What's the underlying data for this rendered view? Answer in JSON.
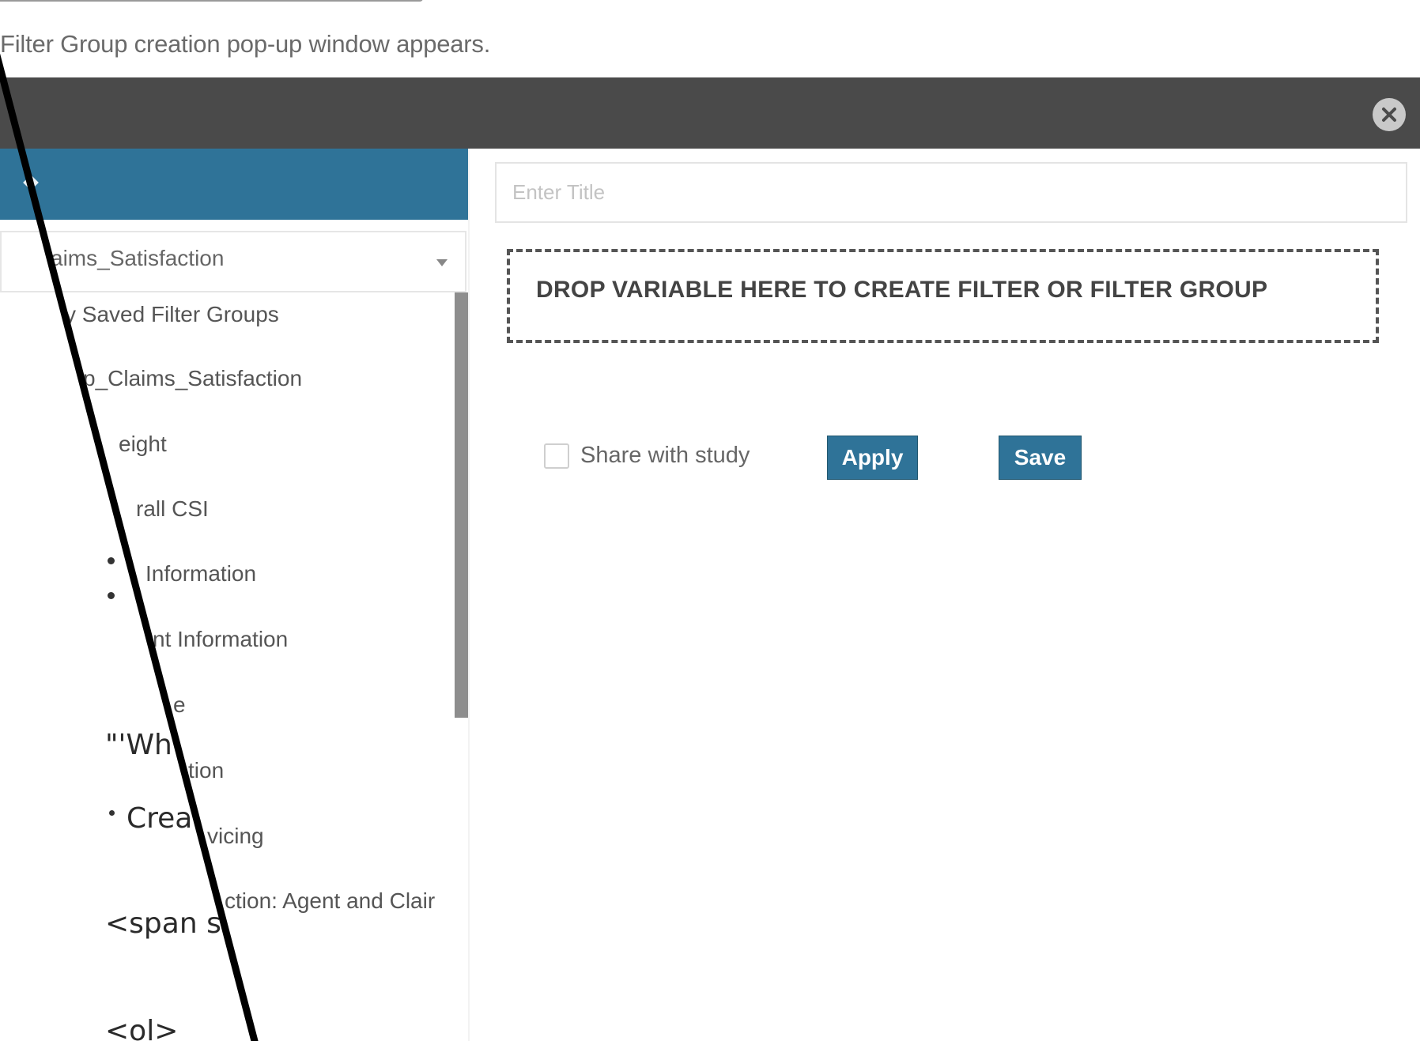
{
  "caption": "Filter Group creation pop-up window appears.",
  "left_panel": {
    "study_select_value": "aims_Satisfaction",
    "tree_items": [
      "y Saved Filter Groups",
      "p_Claims_Satisfaction",
      "eight",
      "rall CSI",
      "Information",
      "nt Information",
      "e",
      "tion",
      "vicing",
      "ction: Agent and Clair"
    ],
    "overlay_fragments": {
      "wh": "\"'Wh",
      "crea": "Crea",
      "span": "<span s",
      "ol": "<ol>"
    }
  },
  "right_panel": {
    "title_placeholder": "Enter Title",
    "drop_zone_text": "DROP VARIABLE HERE TO CREATE FILTER OR FILTER GROUP",
    "share_label": "Share with study",
    "share_checked": false,
    "apply_label": "Apply",
    "save_label": "Save"
  },
  "colors": {
    "modal_header": "#4a4a4a",
    "accent_blue": "#2f7398",
    "close_icon": "#c9c9c9"
  },
  "icons": {
    "close": "close-circle-icon",
    "select_caret": "chevron-down-icon"
  }
}
